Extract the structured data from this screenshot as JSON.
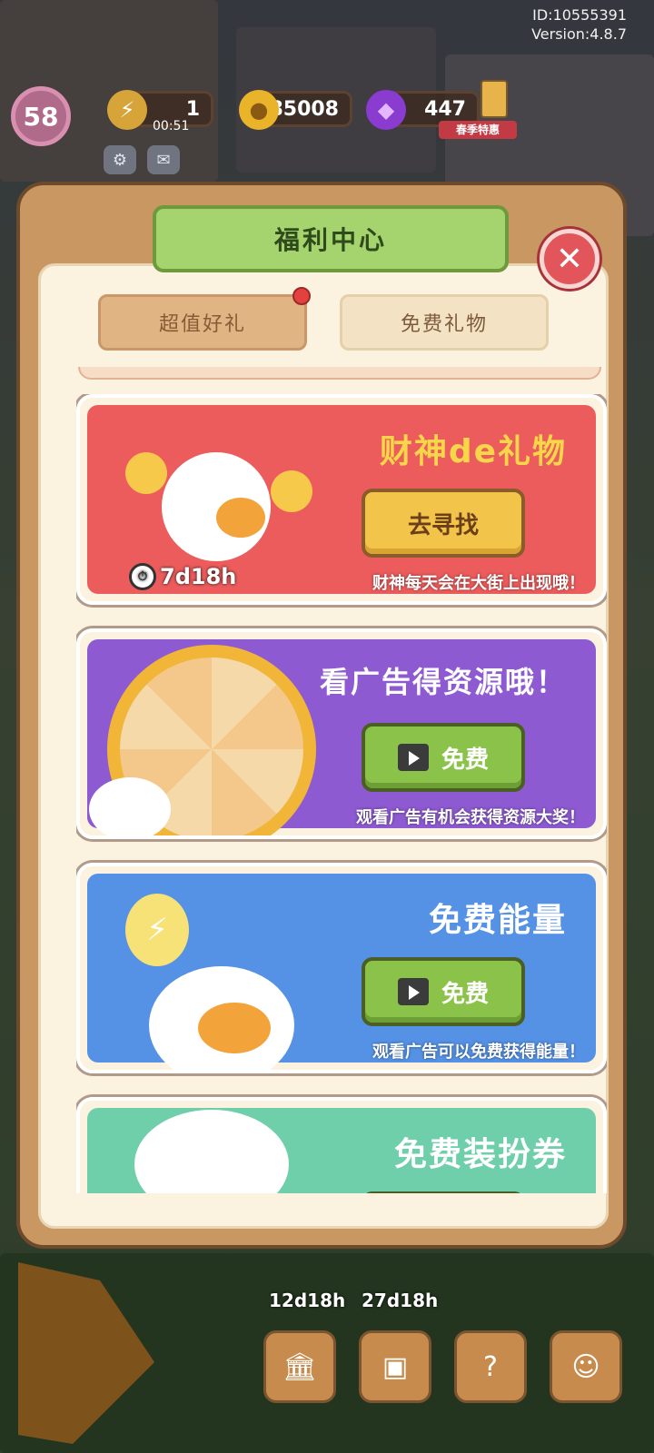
{
  "meta": {
    "id": "ID:10555391",
    "version": "Version:4.8.7"
  },
  "hud": {
    "level": "58",
    "energy": "1",
    "energy_timer": "00:51",
    "coins": "85008",
    "gems": "447",
    "promo_label": "春季特惠"
  },
  "modal": {
    "title": "福利中心",
    "tabs": [
      {
        "label": "超值好礼"
      },
      {
        "label": "免费礼物"
      }
    ],
    "cards": [
      {
        "title": "财神de礼物",
        "button": "去寻找",
        "desc": "财神每天会在大街上出现哦！",
        "timer": "7d18h",
        "color": "#ec5c5c"
      },
      {
        "title": "看广告得资源哦！",
        "button": "免费",
        "desc": "观看广告有机会获得资源大奖！",
        "color": "#8d5ad2"
      },
      {
        "title": "免费能量",
        "button": "免费",
        "desc": "观看广告可以免费获得能量！",
        "color": "#5592e6"
      },
      {
        "title": "免费装扮券",
        "color": "#6fcfaa"
      }
    ]
  },
  "bottom": {
    "timers": [
      "12d18h",
      "27d18h"
    ]
  }
}
